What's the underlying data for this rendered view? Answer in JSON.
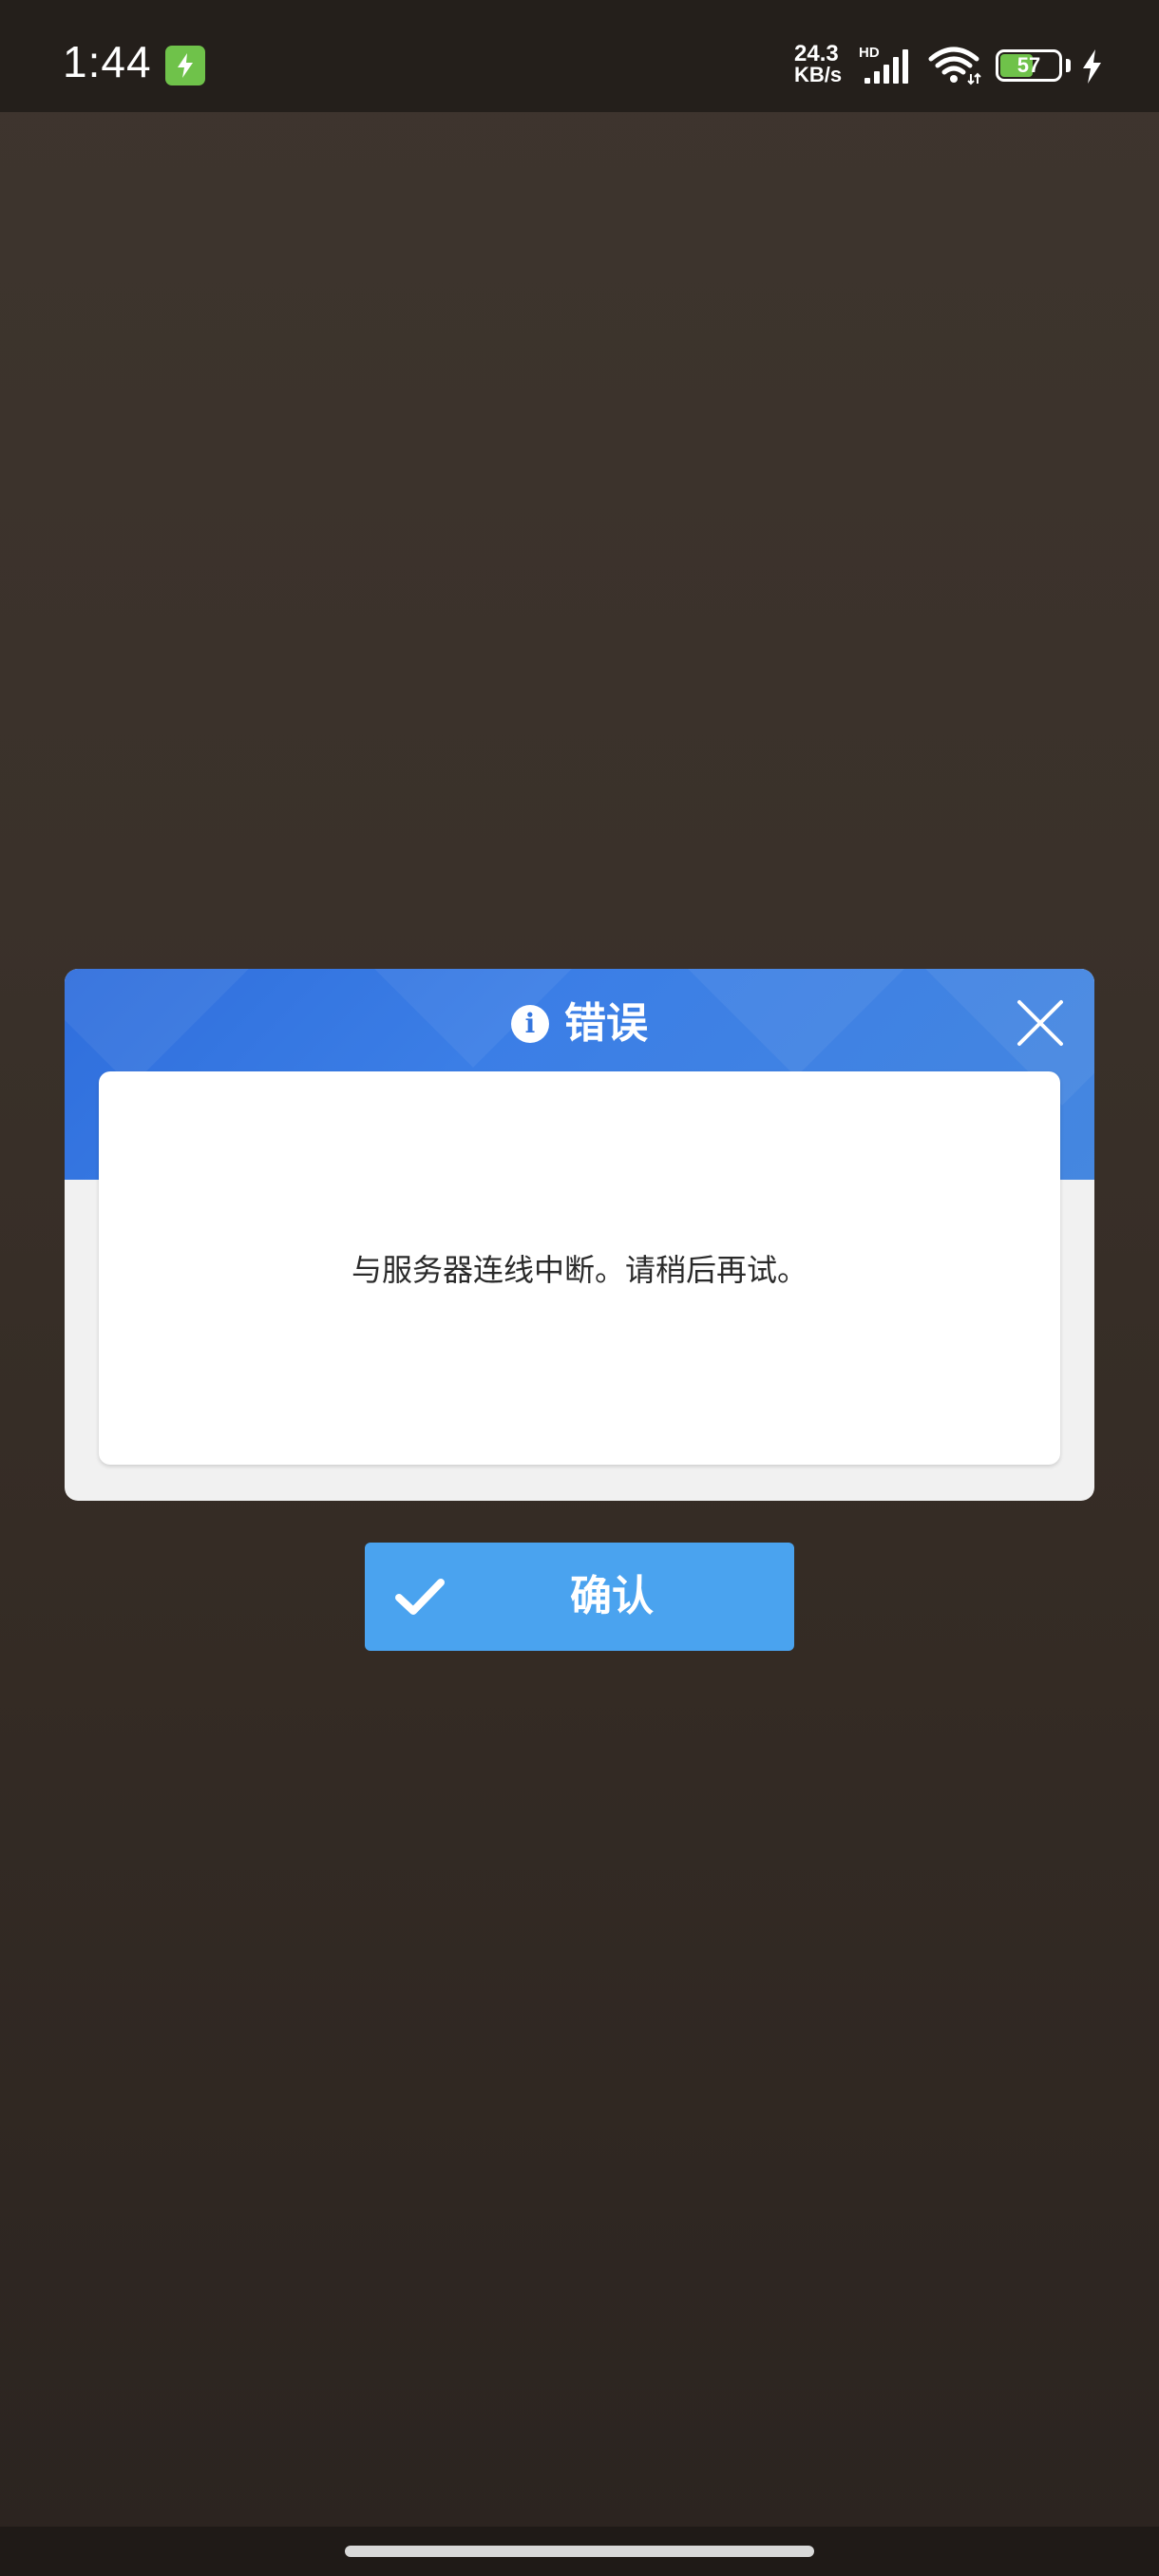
{
  "status_bar": {
    "time": "1:44",
    "net_speed_value": "24.3",
    "net_speed_unit": "KB/s",
    "network_type": "HD",
    "battery_percent": "57",
    "battery_level": 0.57,
    "icons": [
      "charging-app-icon",
      "signal-icon",
      "wifi-icon",
      "battery-icon",
      "charging-bolt-icon"
    ]
  },
  "dialog": {
    "title": "错误",
    "message": "与服务器连线中断。请稍后再试。",
    "header_color": "#3475de",
    "icons": [
      "info-icon",
      "close-icon"
    ]
  },
  "confirm_button": {
    "label": "确认",
    "color": "#4aa3ef",
    "icon": "check-icon"
  }
}
